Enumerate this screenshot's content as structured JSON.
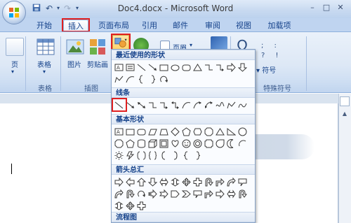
{
  "window": {
    "title": "Doc4.docx - Microsoft Word",
    "controls": [
      "–",
      "□",
      "✕"
    ]
  },
  "quick_access": [
    "save-icon",
    "undo-icon",
    "redo-icon",
    "customize-icon"
  ],
  "tabs": [
    "开始",
    "插入",
    "页面布局",
    "引用",
    "邮件",
    "审阅",
    "视图",
    "加载项"
  ],
  "ribbon": {
    "groups": {
      "pages": {
        "label": "页",
        "item": "页"
      },
      "table": {
        "label": "表格",
        "item": "表格"
      },
      "illustrations": {
        "label": "插图",
        "picture": "图片",
        "clipart": "剪贴画"
      },
      "header": {
        "label": "页眉"
      },
      "symbols": {
        "label": "特殊符号",
        "symbol": "符号",
        "omega": "Ω"
      }
    }
  },
  "shapes_menu": {
    "sections": {
      "recent": "最近使用的形状",
      "lines": "线条",
      "basic": "基本形状",
      "arrows": "箭头总汇",
      "flowchart": "流程图"
    },
    "selected_shape": "line"
  },
  "colors": {
    "highlight": "#e02020",
    "ribbon_text": "#15428b"
  }
}
